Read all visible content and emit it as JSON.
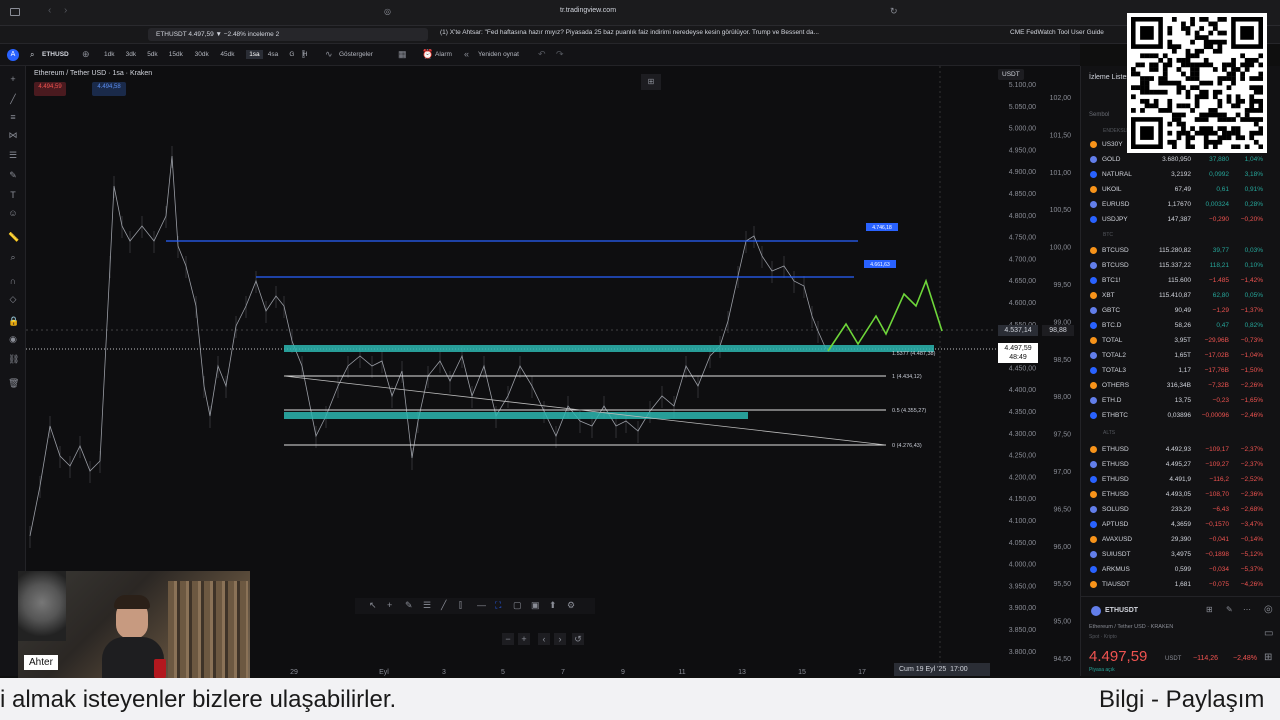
{
  "browser": {
    "url": "tr.tradingview.com",
    "tabs": [
      {
        "label": "ETHUSDT 4.497,59 ▼ −2.48% inceleme 2"
      },
      {
        "label": "(1) X'te Ahtsar: \"Fed haftasına hazır mıyız? Piyasada 25 baz puanlık faiz indirimi neredeyse kesin görülüyor. Trump ve Bessent da..."
      },
      {
        "label": "CME FedWatch Tool User Guide"
      }
    ]
  },
  "toolbar": {
    "symbol": "ETHUSD",
    "intervals": [
      "1dk",
      "3dk",
      "5dk",
      "15dk",
      "30dk",
      "45dk",
      "1sa",
      "4sa",
      "G",
      "H"
    ],
    "active_interval": "1sa",
    "indicators_label": "Göstergeler",
    "alarm_label": "Alarm",
    "replay_label": "Yeniden oynat"
  },
  "legend": {
    "title": "Ethereum / Tether USD · 1sa · Kraken",
    "sell_price": "4.494,59",
    "buy_price": "4.494,58"
  },
  "chart": {
    "currency": "USDT",
    "y_ticks_left": [
      "5.100,00",
      "5.050,00",
      "5.000,00",
      "4.950,00",
      "4.900,00",
      "4.850,00",
      "4.800,00",
      "4.750,00",
      "4.700,00",
      "4.650,00",
      "4.600,00",
      "4.550,00",
      "4.500,00",
      "4.450,00",
      "4.400,00",
      "4.350,00",
      "4.300,00",
      "4.250,00",
      "4.200,00",
      "4.150,00",
      "4.100,00",
      "4.050,00",
      "4.000,00",
      "3.950,00",
      "3.900,00",
      "3.850,00",
      "3.800,00"
    ],
    "y_ticks_right": [
      "102,00",
      "101,50",
      "101,00",
      "100,50",
      "100,00",
      "99,50",
      "99,00",
      "98,50",
      "98,00",
      "97,50",
      "97,00",
      "96,50",
      "96,00",
      "95,50",
      "95,00",
      "94,50"
    ],
    "x_ticks": [
      "29",
      "Eyl",
      "3",
      "5",
      "7",
      "9",
      "11",
      "13",
      "15",
      "17"
    ],
    "cursor_date": "Cum 19 Eyl '25",
    "cursor_time": "17:00",
    "current_price": "4.497,59",
    "current_time": "48:49",
    "secondary_price": "4.537,14",
    "secondary_val": "98,88",
    "level_labels": {
      "upper": "4.746,18",
      "mid": "4.661,63",
      "fib_one": "1 (4.434,12)",
      "fib_half": "0.5 (4.355,27)",
      "fib_zero": "0 (4.276,43)",
      "fib_top": "1.5377 (4.487,38)"
    }
  },
  "watchlist": {
    "title": "İzleme Listesi",
    "symbol_col": "Sembol",
    "section_indices": "ENDEKSLER",
    "section_crypto": "BTC",
    "section_alts": "ALTS",
    "colors": {
      "up": "#26a69a",
      "down": "#ef5350"
    },
    "rows": [
      {
        "sym": "US30Y",
        "last": "",
        "chg": "",
        "pct": "",
        "dir": "up"
      },
      {
        "sym": "GOLD",
        "last": "3.680,950",
        "chg": "37,880",
        "pct": "1,04%",
        "dir": "up"
      },
      {
        "sym": "NATURAL",
        "last": "3,2192",
        "chg": "0,0992",
        "pct": "3,18%",
        "dir": "up"
      },
      {
        "sym": "UKOIL",
        "last": "67,49",
        "chg": "0,61",
        "pct": "0,91%",
        "dir": "up"
      },
      {
        "sym": "EURUSD",
        "last": "1,17670",
        "chg": "0,00324",
        "pct": "0,28%",
        "dir": "up"
      },
      {
        "sym": "USDJPY",
        "last": "147,387",
        "chg": "−0,290",
        "pct": "−0,20%",
        "dir": "down"
      },
      {
        "sym": "BTCUSD",
        "last": "115.280,82",
        "chg": "39,77",
        "pct": "0,03%",
        "dir": "up"
      },
      {
        "sym": "BTCUSD",
        "last": "115.337,22",
        "chg": "118,21",
        "pct": "0,10%",
        "dir": "up"
      },
      {
        "sym": "BTC1!",
        "last": "115.600",
        "chg": "−1.485",
        "pct": "−1,42%",
        "dir": "down"
      },
      {
        "sym": "XBT",
        "last": "115.410,87",
        "chg": "62,80",
        "pct": "0,05%",
        "dir": "up"
      },
      {
        "sym": "GBTC",
        "last": "90,49",
        "chg": "−1,29",
        "pct": "−1,37%",
        "dir": "down"
      },
      {
        "sym": "BTC.D",
        "last": "58,26",
        "chg": "0,47",
        "pct": "0,82%",
        "dir": "up"
      },
      {
        "sym": "TOTAL",
        "last": "3,95T",
        "chg": "−29,96B",
        "pct": "−0,73%",
        "dir": "down"
      },
      {
        "sym": "TOTAL2",
        "last": "1,65T",
        "chg": "−17,02B",
        "pct": "−1,04%",
        "dir": "down"
      },
      {
        "sym": "TOTAL3",
        "last": "1,17",
        "chg": "−17,76B",
        "pct": "−1,50%",
        "dir": "down"
      },
      {
        "sym": "OTHERS",
        "last": "316,34B",
        "chg": "−7,32B",
        "pct": "−2,26%",
        "dir": "down"
      },
      {
        "sym": "ETH.D",
        "last": "13,75",
        "chg": "−0,23",
        "pct": "−1,65%",
        "dir": "down"
      },
      {
        "sym": "ETHBTC",
        "last": "0,03896",
        "chg": "−0,00096",
        "pct": "−2,46%",
        "dir": "down"
      },
      {
        "sym": "ETHUSD",
        "last": "4.492,93",
        "chg": "−109,17",
        "pct": "−2,37%",
        "dir": "down"
      },
      {
        "sym": "ETHUSD",
        "last": "4.495,27",
        "chg": "−109,27",
        "pct": "−2,37%",
        "dir": "down"
      },
      {
        "sym": "ETHUSD",
        "last": "4.491,9",
        "chg": "−116,2",
        "pct": "−2,52%",
        "dir": "down"
      },
      {
        "sym": "ETHUSD",
        "last": "4.493,05",
        "chg": "−108,70",
        "pct": "−2,36%",
        "dir": "down"
      },
      {
        "sym": "SOLUSD",
        "last": "233,29",
        "chg": "−6,43",
        "pct": "−2,68%",
        "dir": "down"
      },
      {
        "sym": "APTUSD",
        "last": "4,3659",
        "chg": "−0,1570",
        "pct": "−3,47%",
        "dir": "down"
      },
      {
        "sym": "AVAXUSD",
        "last": "29,390",
        "chg": "−0,041",
        "pct": "−0,14%",
        "dir": "down"
      },
      {
        "sym": "SUIUSDT",
        "last": "3,4975",
        "chg": "−0,1898",
        "pct": "−5,12%",
        "dir": "down"
      },
      {
        "sym": "ARKMUS",
        "last": "0,599",
        "chg": "−0,034",
        "pct": "−5,37%",
        "dir": "down"
      },
      {
        "sym": "TIAUSDT",
        "last": "1,681",
        "chg": "−0,075",
        "pct": "−4,26%",
        "dir": "down"
      }
    ]
  },
  "detail": {
    "symbol": "ETHUSDT",
    "name": "Ethereum / Tether USD",
    "exchange": "KRAKEN",
    "category": "Spot · Kripto",
    "price": "4.497,59",
    "currency": "USDT",
    "change": "−114,26",
    "change_pct": "−2,48%",
    "status": "Piyasa açık"
  },
  "webcam": {
    "name": "Ahter"
  },
  "subtitles": {
    "left": "i almak isteyenler bizlere ulaşabilirler.",
    "right": "Bilgi - Paylaşım"
  },
  "drawing_toolbar_icons": [
    "cursor-icon",
    "crosshair-icon",
    "brush-icon",
    "fib-icon",
    "trendline-icon",
    "pattern-icon",
    "measure-icon",
    "magnet-icon",
    "text-icon",
    "rect-icon",
    "zoom-icon",
    "settings-icon"
  ]
}
